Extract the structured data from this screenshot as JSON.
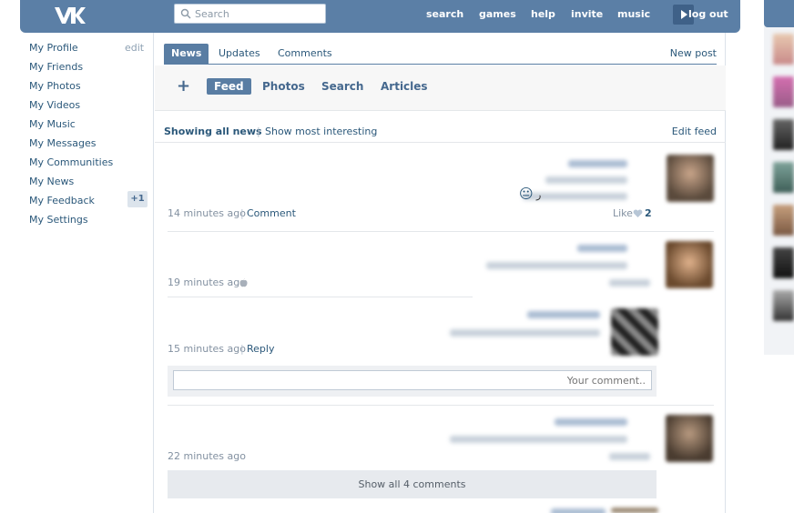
{
  "header": {
    "logo_icon": "vk-logo-icon",
    "search_placeholder": "Search",
    "nav": [
      "search",
      "games",
      "help",
      "invite",
      "music",
      "log out"
    ],
    "play_icon": "play-icon"
  },
  "left_menu": {
    "items": [
      "My Profile",
      "My Friends",
      "My Photos",
      "My Videos",
      "My Music",
      "My Messages",
      "My Communities",
      "My News",
      "My Feedback",
      "My Settings"
    ],
    "edit_label": "edit",
    "feedback_badge": "+1"
  },
  "tabs": {
    "items": [
      "News",
      "Updates",
      "Comments"
    ],
    "active": "News",
    "new_post": "New post"
  },
  "subnav": {
    "plus": "+",
    "items": [
      "Feed",
      "Photos",
      "Search",
      "Articles"
    ],
    "active": "Feed"
  },
  "filter": {
    "showing_all": "Showing all news",
    "separator": "|",
    "most_interesting": "Show most interesting",
    "edit_feed": "Edit feed"
  },
  "posts": [
    {
      "time": "14 minutes ago",
      "separator": "|",
      "action": "Comment",
      "like_label": "Like",
      "like_count": "2",
      "emoji": "😐",
      "emoji_tail": "ر"
    },
    {
      "time": "19 minutes ago",
      "device_icon": "apple-icon"
    },
    {
      "time": "15 minutes ago",
      "separator": "|",
      "action": "Reply"
    },
    {
      "time": "22 minutes ago"
    }
  ],
  "comment_box": {
    "placeholder": "Your comment.."
  },
  "show_all_comments": "Show all 4 comments",
  "colors": {
    "header_bg": "#5b7fa6",
    "accent": "#597da3",
    "link": "#2b587a"
  }
}
